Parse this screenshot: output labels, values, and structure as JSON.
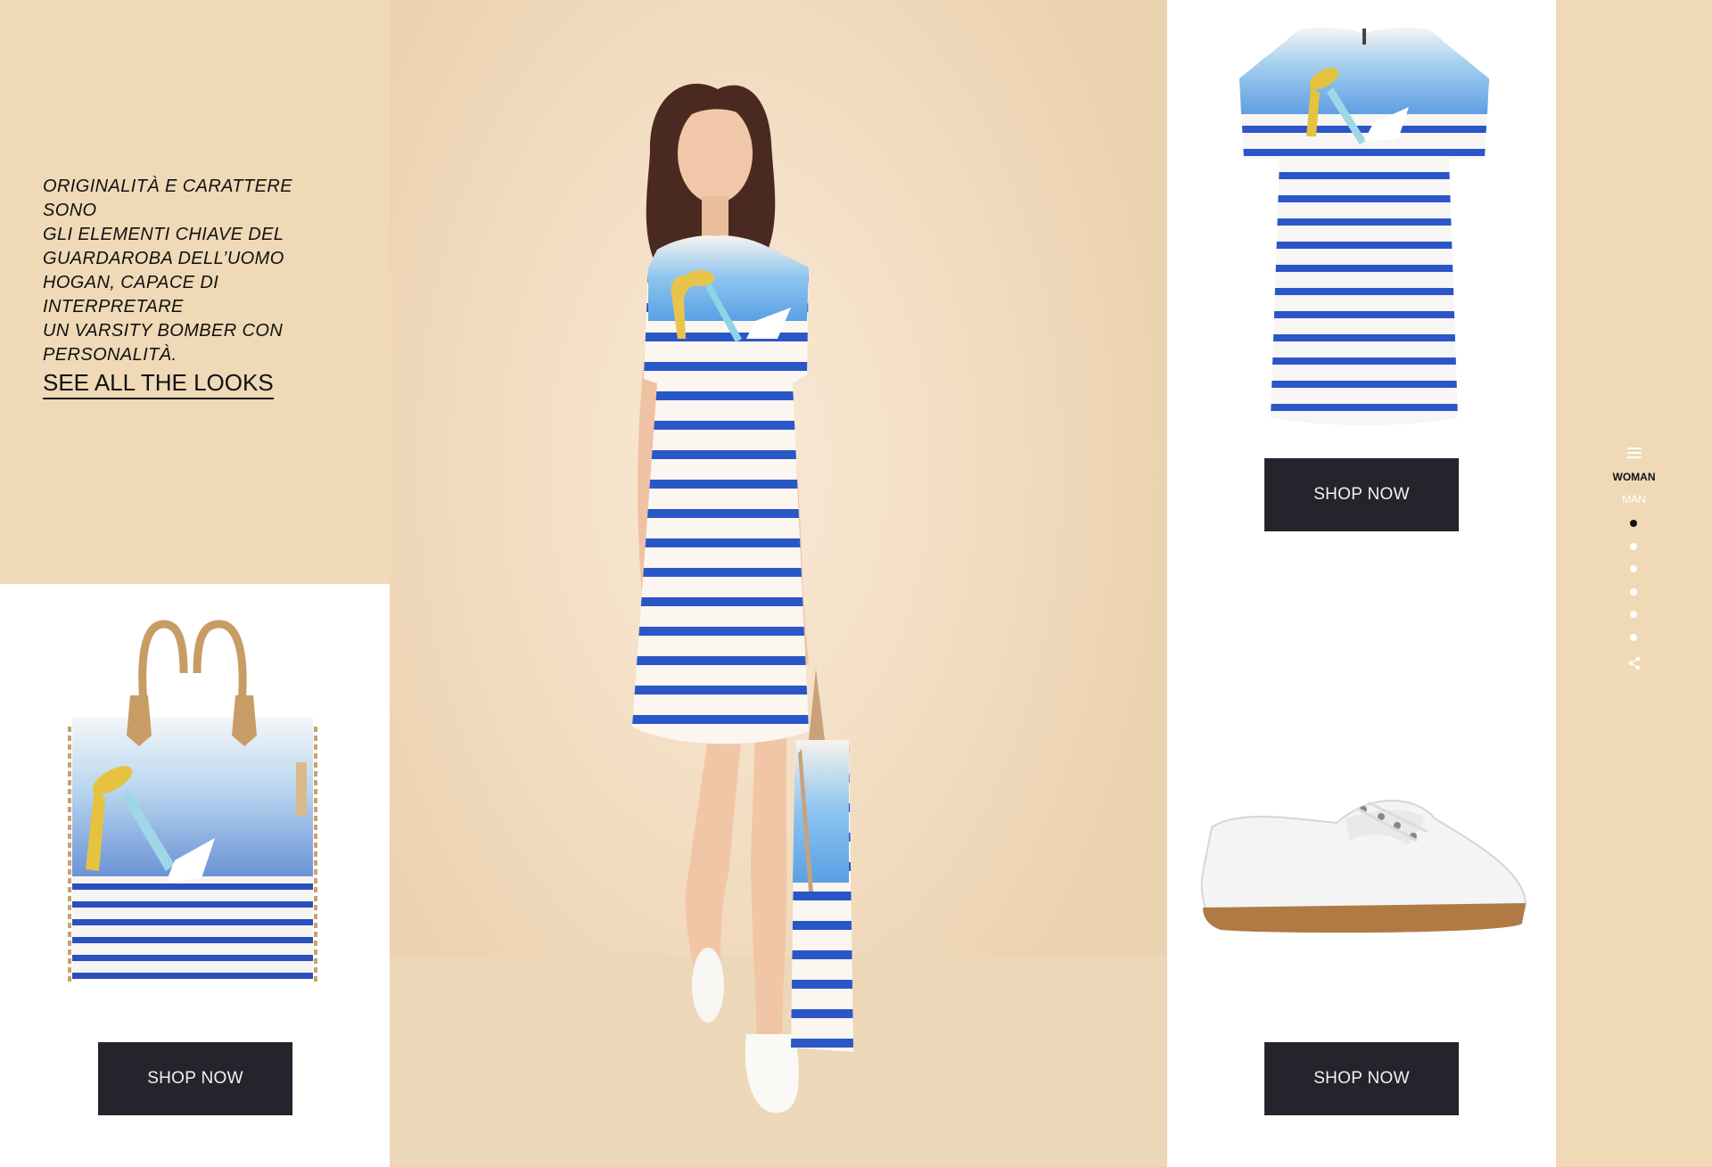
{
  "intro": {
    "lines": [
      "ORIGINALITÀ E CARATTERE SONO",
      "GLI ELEMENTI CHIAVE DEL",
      "GUARDAROBA DELL’UOMO",
      "HOGAN, CAPACE DI INTERPRETARE",
      "UN VARSITY BOMBER CON",
      "PERSONALITÀ."
    ],
    "link": "SEE ALL THE LOOKS"
  },
  "products": {
    "bag": {
      "button": "SHOP NOW"
    },
    "dress": {
      "button": "SHOP NOW"
    },
    "shoe": {
      "button": "SHOP NOW"
    }
  },
  "nav": {
    "menu_icon": "hamburger-icon",
    "woman": "WOMAN",
    "man": "MAN",
    "dots_count": 6,
    "active_dot": 1,
    "share_icon": "share-icon"
  },
  "colors": {
    "beige": "#efd9b7",
    "button": "#24242c",
    "stripe_blue": "#2a57c8"
  }
}
